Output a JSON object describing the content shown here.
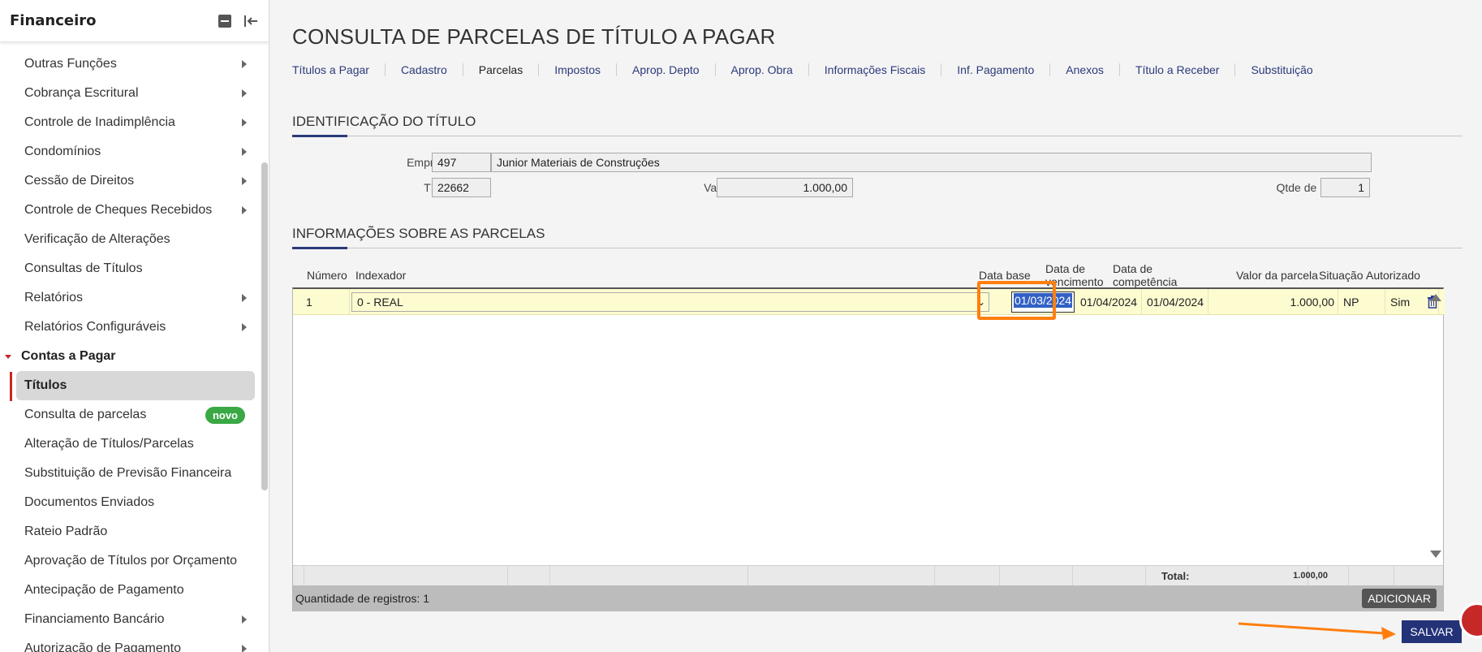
{
  "sidebar": {
    "title": "Financeiro",
    "items": [
      {
        "label": "Outras Funções"
      },
      {
        "label": "Cobrança Escritural"
      },
      {
        "label": "Controle de Inadimplência"
      },
      {
        "label": "Condomínios"
      },
      {
        "label": "Cessão de Direitos"
      },
      {
        "label": "Controle de Cheques Recebidos"
      },
      {
        "label": "Verificação de Alterações"
      },
      {
        "label": "Consultas de Títulos"
      },
      {
        "label": "Relatórios"
      },
      {
        "label": "Relatórios Configuráveis"
      }
    ],
    "section": "Contas a Pagar",
    "sub_items": [
      {
        "label": "Títulos"
      },
      {
        "label": "Consulta de parcelas",
        "badge": "novo"
      },
      {
        "label": "Alteração de Títulos/Parcelas"
      },
      {
        "label": "Substituição de Previsão Financeira"
      },
      {
        "label": "Documentos Enviados"
      },
      {
        "label": "Rateio Padrão"
      },
      {
        "label": "Aprovação de Títulos por Orçamento"
      },
      {
        "label": "Antecipação de Pagamento"
      },
      {
        "label": "Financiamento Bancário"
      },
      {
        "label": "Autorização de Pagamento"
      }
    ]
  },
  "page": {
    "title": "CONSULTA DE PARCELAS DE TÍTULO A PAGAR",
    "tabs": [
      {
        "label": "Títulos a Pagar"
      },
      {
        "label": "Cadastro"
      },
      {
        "label": "Parcelas"
      },
      {
        "label": "Impostos"
      },
      {
        "label": "Aprop. Depto"
      },
      {
        "label": "Aprop. Obra"
      },
      {
        "label": "Informações Fiscais"
      },
      {
        "label": "Inf. Pagamento"
      },
      {
        "label": "Anexos"
      },
      {
        "label": "Título a Receber"
      },
      {
        "label": "Substituição"
      }
    ],
    "active_tab": "Parcelas"
  },
  "identificacao": {
    "section_title": "IDENTIFICAÇÃO DO TÍTULO",
    "empresa_label": "Empresa:",
    "empresa_code": "497",
    "empresa_name": "Junior Materiais de Construções",
    "titulo_label": "Título:",
    "titulo_value": "22662",
    "valor_total_label": "Valor total:",
    "valor_total_value": "1.000,00",
    "qtde_label": "Qtde de parcelas:",
    "qtde_value": "1"
  },
  "parcelas": {
    "section_title": "INFORMAÇÕES SOBRE AS PARCELAS",
    "columns": {
      "numero": "Número",
      "indexador": "Indexador",
      "data_base": "Data base",
      "data_venc_1": "Data de",
      "data_venc_2": "vencimento",
      "data_comp_1": "Data de",
      "data_comp_2": "competência",
      "valor": "Valor da parcela",
      "situacao": "Situação",
      "autorizado": "Autorizado"
    },
    "row": {
      "numero": "1",
      "indexador": "0 - REAL",
      "data_base": "01/03/2024",
      "data_vencimento": "01/04/2024",
      "data_competencia": "01/04/2024",
      "valor": "1.000,00",
      "situacao": "NP",
      "autorizado": "Sim"
    },
    "total_label": "Total:",
    "total_value": "1.000,00",
    "registros_label": "Quantidade de registros: 1",
    "add_label": "ADICIONAR"
  },
  "actions": {
    "save_label": "SALVAR"
  },
  "colors": {
    "accent": "#2b3a7a",
    "highlight": "#ff7f0e",
    "badge": "#3aa845",
    "row_bg": "#fdfbd0"
  }
}
